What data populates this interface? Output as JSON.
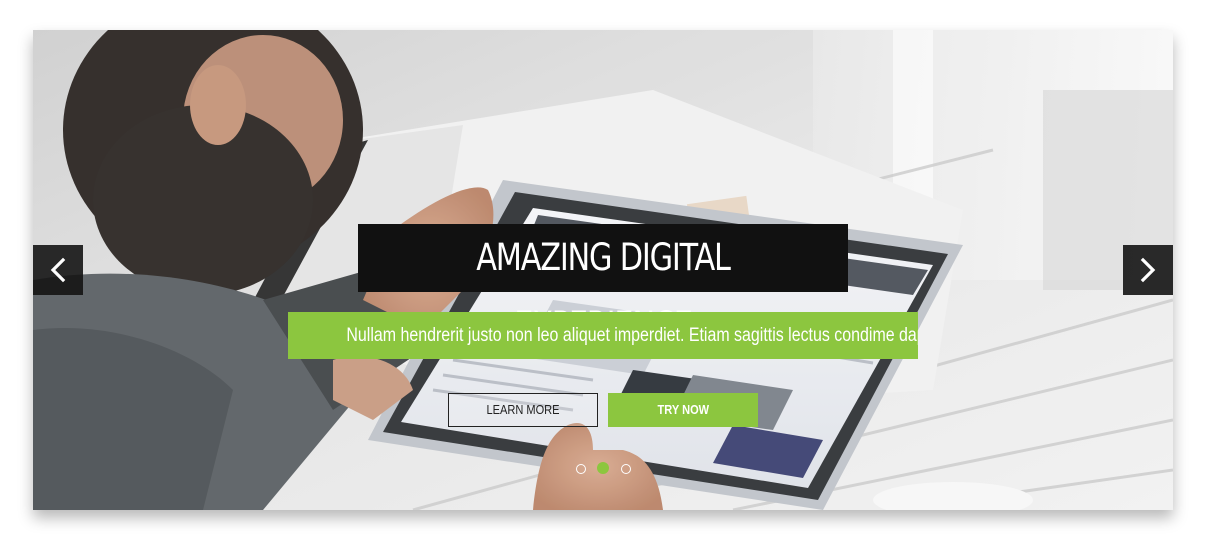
{
  "slide": {
    "headline": "AMAZING DIGITAL EXPERIENCE",
    "subheadline": "Nullam hendrerit justo non leo aliquet imperdiet. Etiam sagittis lectus condime dapibus.",
    "buttons": {
      "learn_more": "LEARN MORE",
      "try_now": "TRY NOW"
    }
  },
  "navigation": {
    "prev_icon": "chevron-left-icon",
    "next_icon": "chevron-right-icon"
  },
  "pagination": {
    "count": 3,
    "active_index": 1
  },
  "colors": {
    "accent": "#8cc63f",
    "headline_bg": "#111111",
    "arrow_bg": "#141414"
  }
}
